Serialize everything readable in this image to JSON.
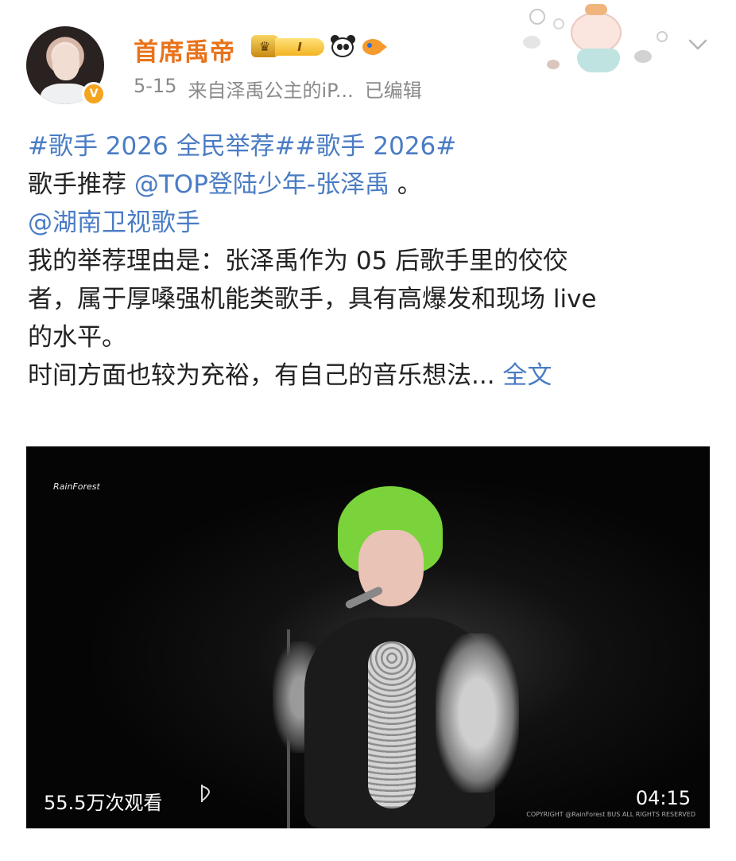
{
  "post": {
    "author": "首席禹帝",
    "vip_level": "I",
    "date": "5-15",
    "source": "来自泽禹公主的iP...",
    "edited": "已编辑",
    "hashtags": "#歌手 2026 全民举荐##歌手 2026#",
    "line2_prefix": "歌手推荐 ",
    "mention1": "@TOP登陆少年-张泽禹",
    "line2_suffix": " 。",
    "mention2": "@湖南卫视歌手",
    "reason_lines": [
      "我的举荐理由是：张泽禹作为 05 后歌手里的佼佼",
      "者，属于厚嗓强机能类歌手，具有高爆发和现场 live",
      "的水平。"
    ],
    "time_line": "时间方面也较为充裕，有自己的音乐想法...",
    "full_text_link": "全文"
  },
  "video": {
    "logo": "RainForest",
    "views": "55.5万次观看",
    "duration": "04:15",
    "copyright": "COPYRIGHT @RainForest BUS ALL RIGHTS RESERVED"
  },
  "colors": {
    "username": "#e8731b",
    "link": "#4a7cc4",
    "meta": "#8a8a8a"
  },
  "icons": [
    "vip-crown-icon",
    "panda-icon",
    "fish-icon",
    "chevron-down-icon",
    "verified-icon",
    "play-icon"
  ]
}
